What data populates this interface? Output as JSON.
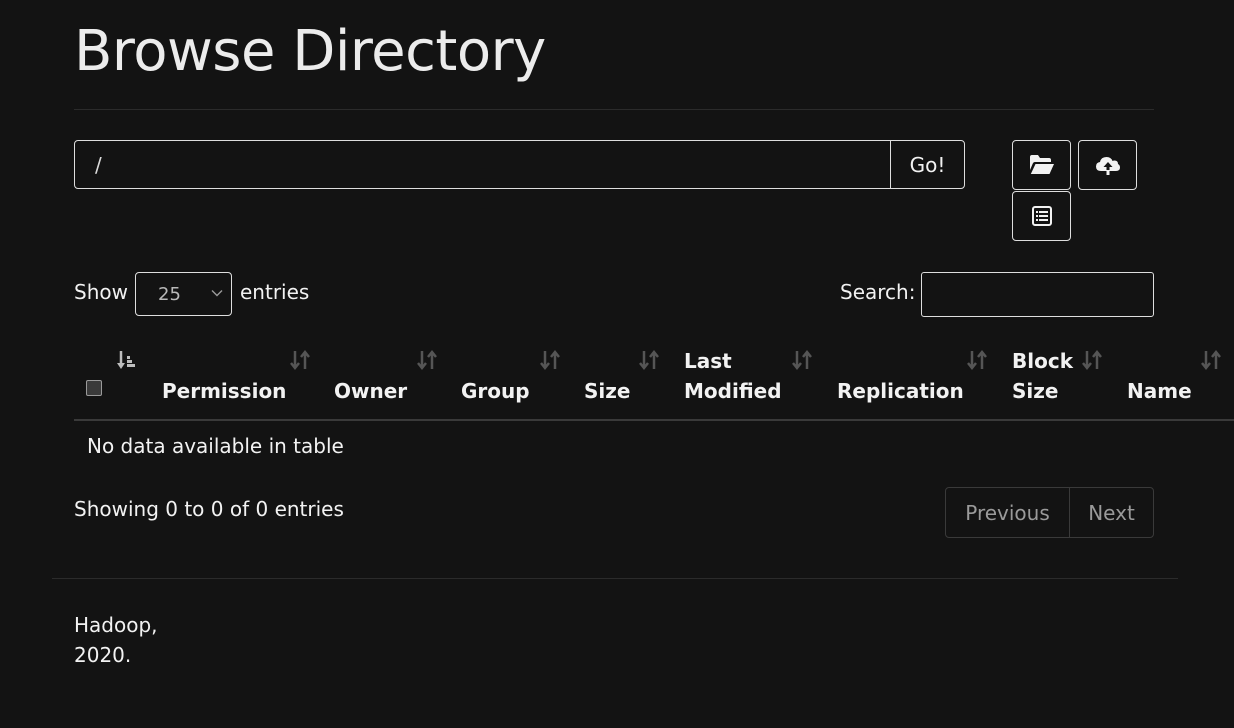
{
  "page": {
    "title": "Browse Directory"
  },
  "path_bar": {
    "value": "/",
    "go_label": "Go!"
  },
  "toolbar": {
    "icons": [
      "folder-open-icon",
      "cloud-upload-icon",
      "list-icon"
    ]
  },
  "table_controls": {
    "show_label": "Show",
    "page_length": "25",
    "entries_label": "entries",
    "search_label": "Search:",
    "search_value": ""
  },
  "table": {
    "columns": [
      {
        "line1": "Permission",
        "line2": ""
      },
      {
        "line1": "Owner",
        "line2": ""
      },
      {
        "line1": "Group",
        "line2": ""
      },
      {
        "line1": "Size",
        "line2": ""
      },
      {
        "line1": "Last",
        "line2": "Modified"
      },
      {
        "line1": "Replication",
        "line2": ""
      },
      {
        "line1": "Block",
        "line2": "Size"
      },
      {
        "line1": "Name",
        "line2": ""
      }
    ],
    "empty_message": "No data available in table"
  },
  "pagination": {
    "info": "Showing 0 to 0 of 0 entries",
    "previous_label": "Previous",
    "next_label": "Next"
  },
  "footer": {
    "line1": "Hadoop,",
    "line2": "2020."
  },
  "colors": {
    "background": "#131313",
    "text": "#f2f2f2",
    "muted": "#9a9a9a",
    "border": "#dedede"
  }
}
